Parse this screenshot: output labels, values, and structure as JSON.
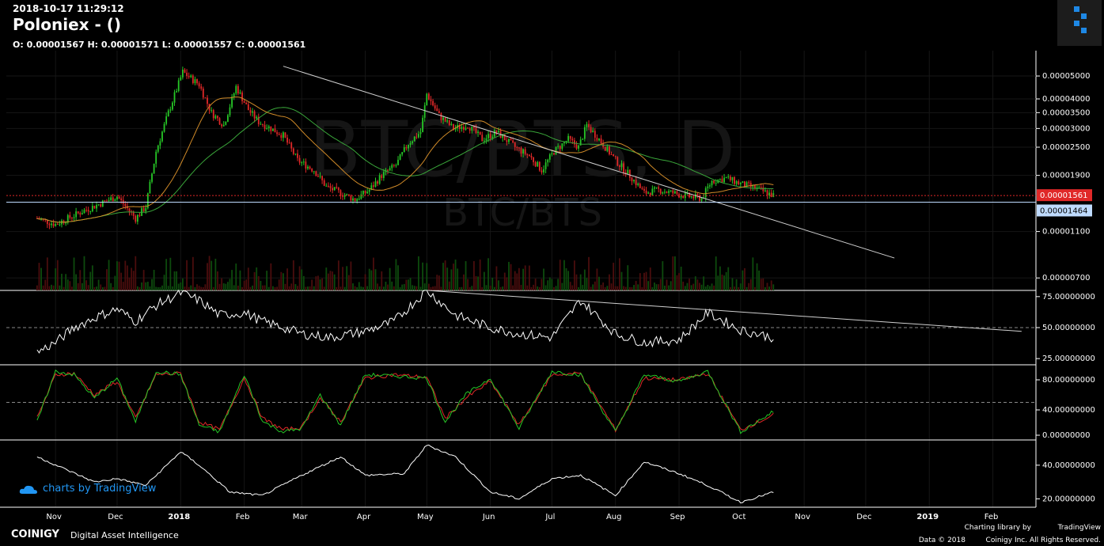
{
  "header": {
    "datetime": "2018-10-17 11:29:12",
    "title": "Poloniex -  ()",
    "ohlc": "O: 0.00001567 H: 0.00001571 L: 0.00001557 C: 0.00001561",
    "watermark_large": "BTC/BTS, D",
    "watermark_small": "BTC/BTS"
  },
  "footer": {
    "tradingview": "charts by TradingView",
    "brand": "COINIGY",
    "tagline": "Digital Asset Intelligence",
    "charting_library": "Charting library by",
    "tv_brand": "TradingView",
    "copyright": "Data © 2018",
    "rights": "Coinigy Inc. All Rights Reserved."
  },
  "colors": {
    "up": "#26c626",
    "down": "#e02828",
    "ma_green": "#3aa63a",
    "ma_orange": "#d08a28",
    "current_price": "#e02828",
    "level": "#bfdbfe"
  },
  "chart_data": [
    {
      "type": "candlestick",
      "title": "BTC/BTS, D",
      "scale": "log",
      "x_ticks": [
        "Nov",
        "Dec",
        "2018",
        "Feb",
        "Mar",
        "Apr",
        "May",
        "Jun",
        "Jul",
        "Aug",
        "Sep",
        "Oct",
        "Nov",
        "Dec",
        "2019",
        "Feb"
      ],
      "y_ticks": [
        "0.00005000",
        "0.00004000",
        "0.00003500",
        "0.00003000",
        "0.00002500",
        "0.00001900",
        "0.00001100",
        "0.00000700"
      ],
      "price_labels": {
        "current": "0.00001561",
        "level": "0.00001464"
      },
      "close_series": {
        "dates": [
          "2017-10-23",
          "2017-11-01",
          "2017-11-15",
          "2017-12-01",
          "2017-12-10",
          "2017-12-15",
          "2017-12-20",
          "2017-12-26",
          "2018-01-02",
          "2018-01-10",
          "2018-01-16",
          "2018-01-22",
          "2018-01-28",
          "2018-02-03",
          "2018-02-08",
          "2018-02-14",
          "2018-02-20",
          "2018-02-27",
          "2018-03-07",
          "2018-03-13",
          "2018-03-20",
          "2018-03-27",
          "2018-04-03",
          "2018-04-09",
          "2018-04-16",
          "2018-04-22",
          "2018-04-28",
          "2018-05-01",
          "2018-05-07",
          "2018-05-14",
          "2018-05-21",
          "2018-05-28",
          "2018-06-04",
          "2018-06-13",
          "2018-06-20",
          "2018-06-26",
          "2018-07-02",
          "2018-07-09",
          "2018-07-14",
          "2018-07-18",
          "2018-07-24",
          "2018-08-01",
          "2018-08-08",
          "2018-08-15",
          "2018-08-22",
          "2018-08-29",
          "2018-09-05",
          "2018-09-12",
          "2018-09-17",
          "2018-09-24",
          "2018-10-01",
          "2018-10-08",
          "2018-10-17"
        ],
        "close": [
          1.25e-05,
          1.18e-05,
          1.35e-05,
          1.55e-05,
          1.25e-05,
          1.4e-05,
          2.4e-05,
          3.5e-05,
          5.2e-05,
          4.6e-05,
          3.5e-05,
          3.1e-05,
          4.5e-05,
          3.6e-05,
          3.2e-05,
          3e-05,
          2.8e-05,
          2.2e-05,
          2e-05,
          1.7e-05,
          1.6e-05,
          1.5e-05,
          1.65e-05,
          1.9e-05,
          2.1e-05,
          2.6e-05,
          2.9e-05,
          4.2e-05,
          3.4e-05,
          3e-05,
          3.1e-05,
          2.7e-05,
          2.9e-05,
          2.5e-05,
          2.3e-05,
          2e-05,
          2.4e-05,
          2.7e-05,
          2.5e-05,
          3.1e-05,
          2.7e-05,
          2.2e-05,
          1.9e-05,
          1.6e-05,
          1.65e-05,
          1.6e-05,
          1.55e-05,
          1.52e-05,
          1.8e-05,
          1.85e-05,
          1.75e-05,
          1.68e-05,
          1.561e-05
        ]
      },
      "volume": true,
      "moving_averages": [
        "green",
        "orange"
      ],
      "trendline": {
        "from": [
          "2018-02-20",
          5.5e-05
        ],
        "to": [
          "2018-12-15",
          8.5e-06
        ]
      }
    },
    {
      "type": "line",
      "indicator": "RSI",
      "y_ticks": [
        "75.00000000",
        "50.00000000",
        "25.00000000"
      ],
      "ylim": [
        20,
        80
      ],
      "dates": [
        "2017-10-23",
        "2017-11-01",
        "2017-11-10",
        "2017-11-20",
        "2017-12-01",
        "2017-12-10",
        "2017-12-20",
        "2018-01-01",
        "2018-01-10",
        "2018-01-20",
        "2018-02-01",
        "2018-02-10",
        "2018-02-20",
        "2018-03-01",
        "2018-03-15",
        "2018-04-01",
        "2018-04-15",
        "2018-05-01",
        "2018-05-15",
        "2018-06-01",
        "2018-06-15",
        "2018-07-01",
        "2018-07-15",
        "2018-08-01",
        "2018-08-15",
        "2018-09-01",
        "2018-09-15",
        "2018-10-01",
        "2018-10-17"
      ],
      "values": [
        30,
        38,
        50,
        58,
        65,
        55,
        68,
        78,
        72,
        60,
        62,
        55,
        50,
        45,
        42,
        47,
        55,
        80,
        60,
        50,
        45,
        42,
        72,
        45,
        38,
        40,
        62,
        48,
        42
      ],
      "trendline": {
        "from": [
          "2018-05-01",
          80
        ],
        "to": [
          "2019-02-15",
          47
        ]
      }
    },
    {
      "type": "line",
      "indicator": "Stochastic",
      "y_ticks": [
        "80.00000000",
        "40.00000000",
        "0.00000000"
      ],
      "ylim": [
        0,
        100
      ],
      "dates": [
        "2017-10-23",
        "2017-11-01",
        "2017-11-10",
        "2017-11-20",
        "2017-12-01",
        "2017-12-10",
        "2017-12-20",
        "2018-01-01",
        "2018-01-10",
        "2018-01-20",
        "2018-02-01",
        "2018-02-10",
        "2018-02-20",
        "2018-03-01",
        "2018-03-10",
        "2018-03-20",
        "2018-04-01",
        "2018-04-15",
        "2018-05-01",
        "2018-05-10",
        "2018-05-20",
        "2018-06-01",
        "2018-06-15",
        "2018-07-01",
        "2018-07-15",
        "2018-08-01",
        "2018-08-15",
        "2018-09-01",
        "2018-09-15",
        "2018-10-01",
        "2018-10-17"
      ],
      "series": [
        {
          "values": [
            20,
            95,
            90,
            55,
            85,
            20,
            95,
            90,
            15,
            5,
            90,
            20,
            5,
            10,
            60,
            15,
            90,
            88,
            85,
            20,
            60,
            85,
            10,
            95,
            90,
            5,
            90,
            80,
            95,
            5,
            35
          ]
        },
        {
          "values": [
            25,
            90,
            92,
            60,
            80,
            25,
            90,
            92,
            20,
            8,
            85,
            25,
            8,
            12,
            55,
            20,
            85,
            90,
            86,
            25,
            55,
            80,
            15,
            90,
            92,
            8,
            85,
            82,
            92,
            8,
            30
          ]
        }
      ]
    },
    {
      "type": "line",
      "indicator": "Oscillator",
      "y_ticks": [
        "40.00000000",
        "20.00000000"
      ],
      "ylim": [
        15,
        55
      ],
      "dates": [
        "2017-10-23",
        "2017-11-05",
        "2017-11-20",
        "2017-12-01",
        "2017-12-15",
        "2018-01-01",
        "2018-01-10",
        "2018-01-25",
        "2018-02-10",
        "2018-03-01",
        "2018-03-20",
        "2018-04-01",
        "2018-04-20",
        "2018-05-01",
        "2018-05-15",
        "2018-06-01",
        "2018-06-15",
        "2018-07-01",
        "2018-07-15",
        "2018-08-01",
        "2018-08-15",
        "2018-09-01",
        "2018-09-15",
        "2018-10-01",
        "2018-10-17"
      ],
      "values": [
        45,
        38,
        30,
        32,
        28,
        48,
        40,
        24,
        22,
        34,
        45,
        34,
        35,
        52,
        45,
        24,
        20,
        32,
        34,
        22,
        42,
        35,
        28,
        18,
        24
      ]
    }
  ]
}
